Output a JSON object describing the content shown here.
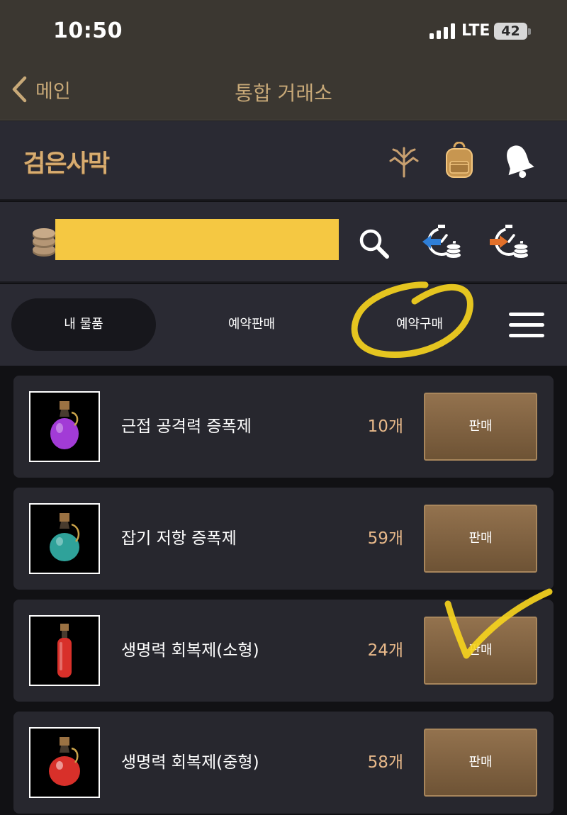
{
  "status_bar": {
    "time": "10:50",
    "network": "LTE",
    "battery": "42"
  },
  "nav": {
    "back_label": "메인",
    "title": "통합 거래소"
  },
  "header": {
    "logo_text": "검은사막",
    "icons": [
      "tree-icon",
      "backpack-icon",
      "bell-icon"
    ]
  },
  "currency_bar": {
    "icons": [
      "coins-icon",
      "search-icon",
      "reservation-sell-history-icon",
      "reservation-buy-history-icon"
    ]
  },
  "tabs": [
    {
      "label": "내 물품",
      "active": true
    },
    {
      "label": "예약판매",
      "active": false
    },
    {
      "label": "예약구매",
      "active": false
    }
  ],
  "items": [
    {
      "name": "근접 공격력 증폭제",
      "count": "10개",
      "button": "판매",
      "potion_color": "#a23bd6"
    },
    {
      "name": "잡기 저항 증폭제",
      "count": "59개",
      "button": "판매",
      "potion_color": "#2fa29a"
    },
    {
      "name": "생명력 회복제(소형)",
      "count": "24개",
      "button": "판매",
      "potion_color": "#d8302a"
    },
    {
      "name": "생명력 회복제(중형)",
      "count": "58개",
      "button": "판매",
      "potion_color": "#d8302a"
    }
  ],
  "colors": {
    "accent_gold": "#c8a978",
    "highlight_marker": "#f5d21e",
    "sell_button": "#8a6a45"
  }
}
